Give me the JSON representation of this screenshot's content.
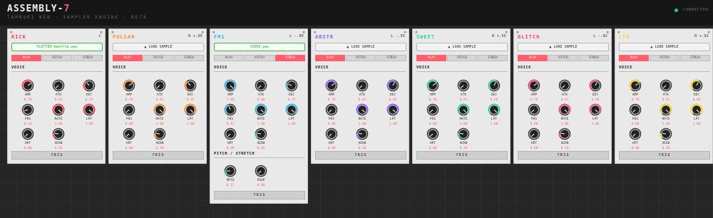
{
  "app": {
    "title_main": "ASSEMBLY-",
    "title_accent": "7",
    "subtitle": "TAMBURI WEB · SAMPLER ENGINE · BETA",
    "status": "CONNECTED",
    "status_color": "#2ecc71",
    "accent": "#ff5f6d"
  },
  "load_label": "▲ LOAD SAMPLE",
  "trig_label": "TRIG",
  "close_glyph": "×",
  "mode_labels": [
    "PLAY",
    "PITCH",
    "STRCH"
  ],
  "voice_label": "VOICE",
  "pitch_stretch_label": "PITCH / STRETCH",
  "panels": [
    {
      "id": "kick",
      "name": "KICK",
      "color": "#ff3b4e",
      "pan": "C",
      "sample": "PLOTTER-meettta.wav",
      "loaded": true,
      "mode": 0,
      "knobs": [
        {
          "label": "AMP",
          "value": "0.70"
        },
        {
          "label": "ATK",
          "value": "0.01"
        },
        {
          "label": "DEC",
          "value": "0.35"
        },
        {
          "label": "POS",
          "value": "0.10"
        },
        {
          "label": "RATE",
          "value": "1.00"
        },
        {
          "label": "LPF",
          "value": "1.00"
        },
        {
          "label": "HPF",
          "value": "0.00"
        },
        {
          "label": "VERB",
          "value": "0.20"
        }
      ]
    },
    {
      "id": "pulsar",
      "name": "PULSAR",
      "color": "#ff8a2a",
      "pan": "R +.05",
      "sample": "",
      "loaded": false,
      "mode": 0,
      "knobs": [
        {
          "label": "AMP",
          "value": "0.70"
        },
        {
          "label": "ATK",
          "value": "0.01"
        },
        {
          "label": "DEC",
          "value": "0.35"
        },
        {
          "label": "POS",
          "value": "0.00"
        },
        {
          "label": "RATE",
          "value": "1.00"
        },
        {
          "label": "LPF",
          "value": "1.00"
        },
        {
          "label": "HPF",
          "value": "0.00"
        },
        {
          "label": "VERB",
          "value": "0.20"
        }
      ]
    },
    {
      "id": "fm1",
      "name": "FM1",
      "color": "#2bb9e0",
      "pan": "L -.05",
      "sample": "VIDEO.wav",
      "loaded": true,
      "mode": 2,
      "knobs": [
        {
          "label": "AMP",
          "value": "1.00"
        },
        {
          "label": "ATK",
          "value": "0.00"
        },
        {
          "label": "DEC",
          "value": "0.25"
        },
        {
          "label": "POS",
          "value": "0.42"
        },
        {
          "label": "RATE",
          "value": "1.00"
        },
        {
          "label": "LPF",
          "value": "1.00"
        },
        {
          "label": "HPF",
          "value": "0.00"
        },
        {
          "label": "VERB",
          "value": "0.20"
        }
      ],
      "stretch": [
        {
          "label": "PRTO",
          "value": "0.17"
        },
        {
          "label": "PSHP",
          "value": "0.00"
        }
      ]
    },
    {
      "id": "abstr",
      "name": "ABSTR",
      "color": "#8a5cf5",
      "pan": "L -.55",
      "sample": "",
      "loaded": false,
      "mode": 0,
      "knobs": [
        {
          "label": "AMP",
          "value": "0.70"
        },
        {
          "label": "ATK",
          "value": "0.01"
        },
        {
          "label": "DEC",
          "value": "0.60"
        },
        {
          "label": "POS",
          "value": "0.00"
        },
        {
          "label": "RATE",
          "value": "1.00"
        },
        {
          "label": "LPF",
          "value": "1.00"
        },
        {
          "label": "HPF",
          "value": "0.00"
        },
        {
          "label": "VERB",
          "value": "0.20"
        }
      ]
    },
    {
      "id": "sweet",
      "name": "SWEET",
      "color": "#22d3a5",
      "pan": "R +.55",
      "sample": "",
      "loaded": false,
      "mode": 0,
      "knobs": [
        {
          "label": "AMP",
          "value": "0.70"
        },
        {
          "label": "ATK",
          "value": "0.01"
        },
        {
          "label": "DEC",
          "value": "0.60"
        },
        {
          "label": "POS",
          "value": "0.00"
        },
        {
          "label": "RATE",
          "value": "1.00"
        },
        {
          "label": "LPF",
          "value": "1.00"
        },
        {
          "label": "HPF",
          "value": "0.00"
        },
        {
          "label": "VERB",
          "value": "0.20"
        }
      ]
    },
    {
      "id": "glitch",
      "name": "GLITCH",
      "color": "#ff3b7a",
      "pan": "L -.92",
      "sample": "",
      "loaded": false,
      "mode": 0,
      "knobs": [
        {
          "label": "AMP",
          "value": "0.70"
        },
        {
          "label": "ATK",
          "value": "0.01"
        },
        {
          "label": "DEC",
          "value": "0.60"
        },
        {
          "label": "POS",
          "value": "0.00"
        },
        {
          "label": "RATE",
          "value": "1.00"
        },
        {
          "label": "LPF",
          "value": "1.00"
        },
        {
          "label": "HPF",
          "value": "0.00"
        },
        {
          "label": "VERB",
          "value": "0.20"
        }
      ]
    },
    {
      "id": "lps",
      "name": "LPS",
      "color": "#ffd21f",
      "pan": "R +.92",
      "sample": "",
      "loaded": false,
      "mode": 0,
      "knobs": [
        {
          "label": "AMP",
          "value": "0.70"
        },
        {
          "label": "ATK",
          "value": "0.01"
        },
        {
          "label": "DEC",
          "value": "0.60"
        },
        {
          "label": "POS",
          "value": "0.00"
        },
        {
          "label": "RATE",
          "value": "1.00"
        },
        {
          "label": "LPF",
          "value": "1.00"
        },
        {
          "label": "HPF",
          "value": "0.00"
        },
        {
          "label": "VERB",
          "value": "0.20"
        }
      ]
    }
  ]
}
